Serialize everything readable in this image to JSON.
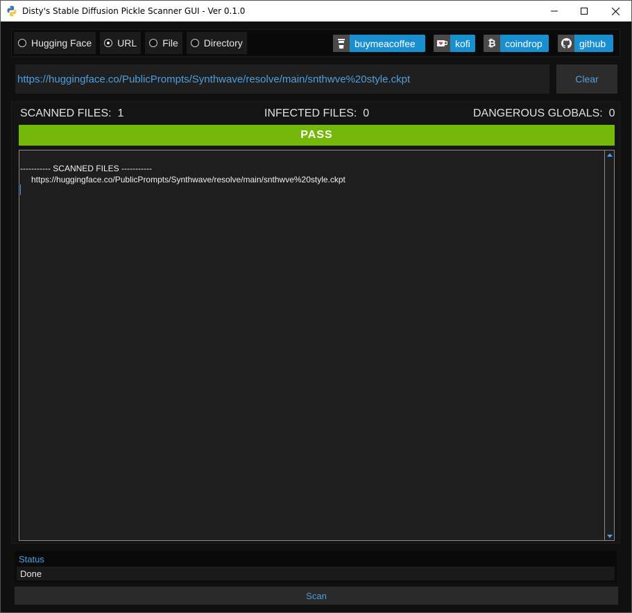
{
  "window": {
    "title": "Disty's Stable Diffusion Pickle Scanner GUI - Ver 0.1.0",
    "controls": {
      "minimize": "—",
      "maximize": "☐",
      "close": "✕"
    }
  },
  "source_options": [
    {
      "label": "Hugging Face",
      "checked": false
    },
    {
      "label": "URL",
      "checked": true
    },
    {
      "label": "File",
      "checked": false
    },
    {
      "label": "Directory",
      "checked": false
    }
  ],
  "links": {
    "buymeacoffee": {
      "label": "buymeacoffee",
      "icon": "coffee-cup-icon"
    },
    "kofi": {
      "label": "kofi",
      "icon": "kofi-cup-icon"
    },
    "coindrop": {
      "label": "coindrop",
      "icon": "bitcoin-icon"
    },
    "github": {
      "label": "github",
      "icon": "github-icon"
    }
  },
  "url_input": {
    "value": "https://huggingface.co/PublicPrompts/Synthwave/resolve/main/snthwve%20style.ckpt"
  },
  "clear_label": "Clear",
  "stats": {
    "scanned_label": "SCANNED FILES:",
    "scanned_value": "1",
    "infected_label": "INFECTED FILES:",
    "infected_value": "0",
    "dangerous_label": "DANGEROUS GLOBALS:",
    "dangerous_value": "0"
  },
  "result": {
    "label": "PASS",
    "color": "#74b80a"
  },
  "log": {
    "header": "----------- SCANNED FILES -----------",
    "entries": [
      "https://huggingface.co/PublicPrompts/Synthwave/resolve/main/snthwve%20style.ckpt"
    ]
  },
  "status": {
    "label": "Status",
    "value": "Done"
  },
  "scan_label": "Scan",
  "colors": {
    "accent": "#4d9fe0",
    "link_bg": "#1a8fd0",
    "pass": "#74b80a"
  }
}
